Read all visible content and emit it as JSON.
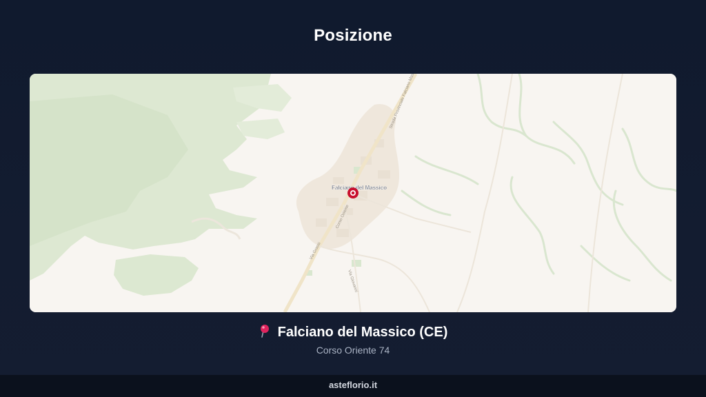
{
  "header": {
    "title": "Posizione"
  },
  "map": {
    "town_label": "Falciano del Massico",
    "road_labels": {
      "provincial": "Strada Provinciale Falciano Massico",
      "corso": "Corso Oriente",
      "via_a": "Via Grassi",
      "via_b": "Via Giovanni"
    },
    "marker_color": "#c8102e"
  },
  "location": {
    "pin_icon": "round-pushpin-icon",
    "place_name": "Falciano del Massico (CE)",
    "address": "Corso Oriente 74"
  },
  "footer": {
    "site": "asteflorio.it"
  }
}
